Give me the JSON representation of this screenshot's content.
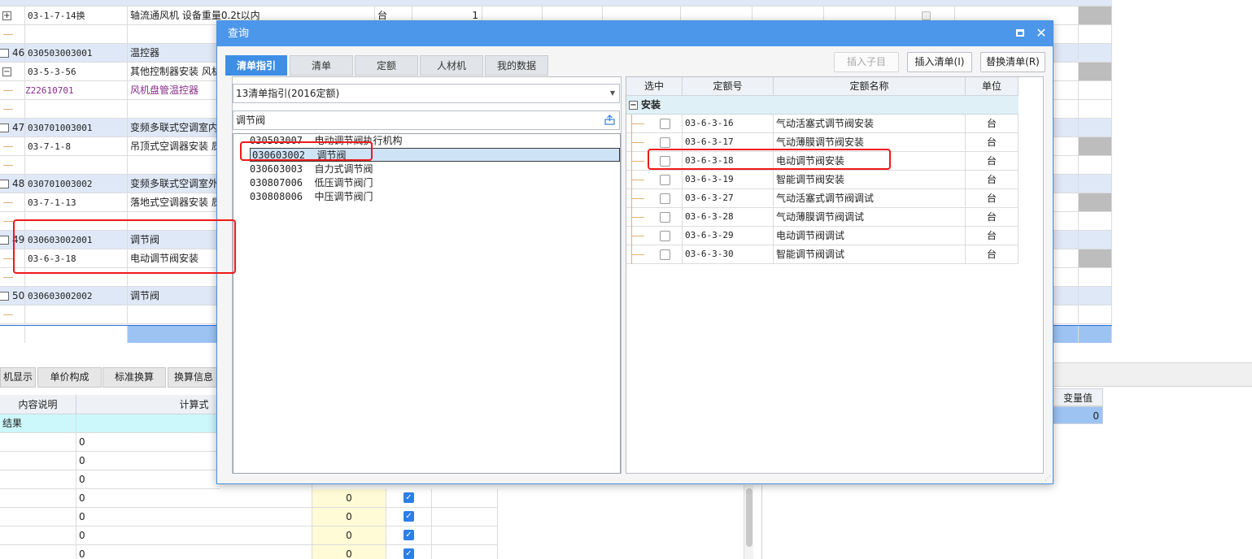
{
  "background_table": {
    "rows": [
      {
        "type": "de",
        "a": "+",
        "code": "03-1-7-14换",
        "name": "轴流通风机 设备重量0.2t以内",
        "unit": "台",
        "qty": "1",
        "check": true
      },
      {
        "type": "blank"
      },
      {
        "type": "qd",
        "a": "46",
        "code": "030503003001",
        "name": "温控器"
      },
      {
        "type": "de",
        "a": "−",
        "code": "03-5-3-56",
        "name": "其他控制器安装 风机"
      },
      {
        "type": "sub",
        "code": "Z22610701",
        "name": "风机盘管温控器"
      },
      {
        "type": "blank"
      },
      {
        "type": "qd",
        "a": "47",
        "code": "030701003001",
        "name": "变频多联式空调室内"
      },
      {
        "type": "de",
        "code": "03-7-1-8",
        "name": "吊顶式空调器安装 质"
      },
      {
        "type": "blank"
      },
      {
        "type": "qd",
        "a": "48",
        "code": "030701003002",
        "name": "变频多联式空调室外"
      },
      {
        "type": "de",
        "code": "03-7-1-13",
        "name": "落地式空调器安装 质"
      },
      {
        "type": "blank"
      },
      {
        "type": "qd",
        "a": "49",
        "code": "030603002001",
        "name": "调节阀"
      },
      {
        "type": "de",
        "code": "03-6-3-18",
        "name": "电动调节阀安装"
      },
      {
        "type": "blank"
      },
      {
        "type": "qd",
        "a": "50",
        "code": "030603002002",
        "name": "调节阀"
      },
      {
        "type": "blank"
      },
      {
        "type": "selected"
      }
    ]
  },
  "lower_tabs": [
    "机显示",
    "单价构成",
    "标准换算",
    "换算信息"
  ],
  "lower_grid": {
    "headers": [
      "内容说明",
      "计算式"
    ],
    "group_label": "结果",
    "rows": [
      {
        "formula": "0"
      },
      {
        "formula": "0"
      },
      {
        "formula": "0"
      },
      {
        "formula": "0",
        "value": "0",
        "checked": true
      },
      {
        "formula": "0",
        "value": "0",
        "checked": true
      },
      {
        "formula": "0",
        "value": "0",
        "checked": true
      },
      {
        "formula": "0",
        "value": "0",
        "checked": true
      }
    ]
  },
  "variable_panel": {
    "header": "变量值",
    "value": "0"
  },
  "dialog": {
    "title": "查询",
    "tabs": [
      "清单指引",
      "清单",
      "定额",
      "人材机",
      "我的数据"
    ],
    "active_tab": 0,
    "buttons": {
      "insert_child": "插入子目",
      "insert_list": "插入清单(I)",
      "replace_list": "替换清单(R)"
    },
    "library_select": "13清单指引(2016定额)",
    "search_value": "调节阀",
    "results": [
      {
        "code": "030503007",
        "name": "电动调节阀执行机构"
      },
      {
        "code": "030603002",
        "name": "调节阀",
        "selected": true
      },
      {
        "code": "030603003",
        "name": "自力式调节阀"
      },
      {
        "code": "030807006",
        "name": "低压调节阀门"
      },
      {
        "code": "030808006",
        "name": "中压调节阀门"
      }
    ],
    "quota_table": {
      "headers": [
        "选中",
        "定额号",
        "定额名称",
        "单位"
      ],
      "group": "安装",
      "rows": [
        {
          "code": "03-6-3-16",
          "name": "气动活塞式调节阀安装",
          "unit": "台"
        },
        {
          "code": "03-6-3-17",
          "name": "气动薄膜调节阀安装",
          "unit": "台"
        },
        {
          "code": "03-6-3-18",
          "name": "电动调节阀安装",
          "unit": "台"
        },
        {
          "code": "03-6-3-19",
          "name": "智能调节阀安装",
          "unit": "台"
        },
        {
          "code": "03-6-3-27",
          "name": "气动活塞式调节阀调试",
          "unit": "台"
        },
        {
          "code": "03-6-3-28",
          "name": "气动薄膜调节阀调试",
          "unit": "台"
        },
        {
          "code": "03-6-3-29",
          "name": "电动调节阀调试",
          "unit": "台"
        },
        {
          "code": "03-6-3-30",
          "name": "智能调节阀调试",
          "unit": "台"
        }
      ]
    }
  },
  "colors": {
    "title_bar": "#4c97ea",
    "active_tab": "#3e8ee6",
    "annotation": "#f01818",
    "list_row": "#dfe8f7"
  }
}
